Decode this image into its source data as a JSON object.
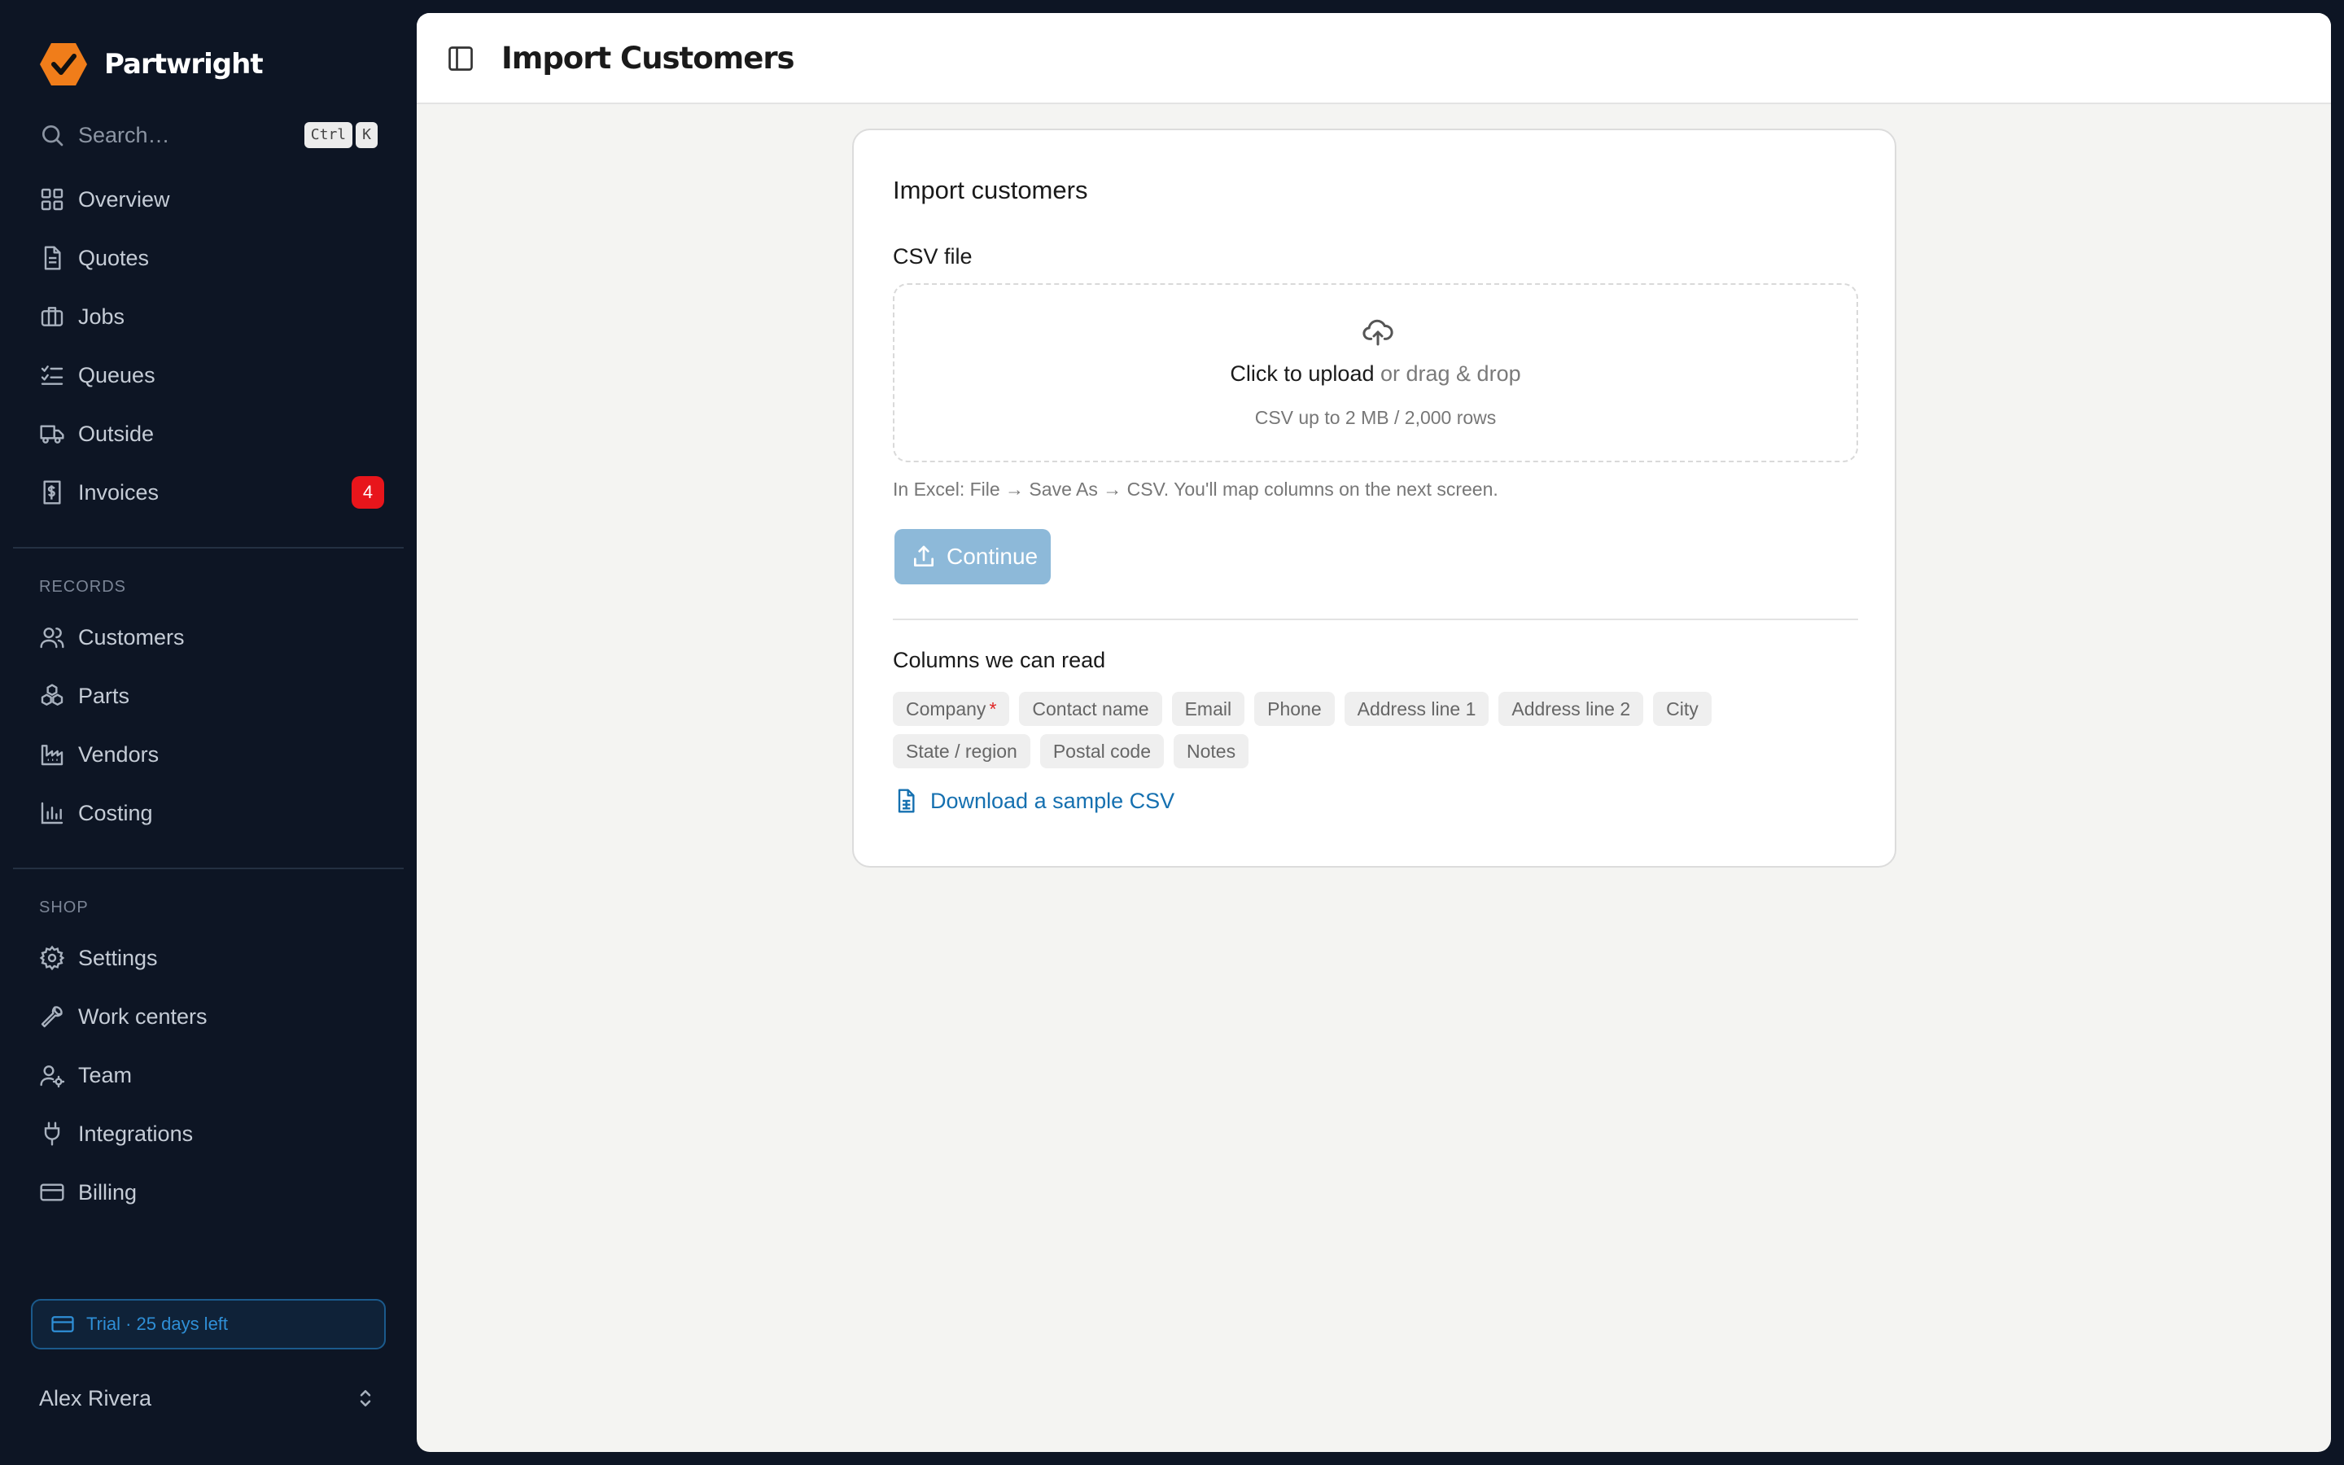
{
  "app": {
    "name": "Partwright"
  },
  "search": {
    "placeholder": "Search…",
    "shortcut": [
      "Ctrl",
      "K"
    ]
  },
  "nav_main": [
    {
      "label": "Overview",
      "icon": "grid-icon"
    },
    {
      "label": "Quotes",
      "icon": "document-icon"
    },
    {
      "label": "Jobs",
      "icon": "briefcase-icon"
    },
    {
      "label": "Queues",
      "icon": "checklist-icon"
    },
    {
      "label": "Outside",
      "icon": "truck-icon"
    },
    {
      "label": "Invoices",
      "icon": "invoice-icon",
      "badge": "4"
    }
  ],
  "sections": {
    "records": {
      "label": "RECORDS",
      "items": [
        {
          "label": "Customers",
          "icon": "users-icon"
        },
        {
          "label": "Parts",
          "icon": "parts-icon"
        },
        {
          "label": "Vendors",
          "icon": "factory-icon"
        },
        {
          "label": "Costing",
          "icon": "bar-chart-icon"
        }
      ]
    },
    "shop": {
      "label": "SHOP",
      "items": [
        {
          "label": "Settings",
          "icon": "gear-icon"
        },
        {
          "label": "Work centers",
          "icon": "wrench-icon"
        },
        {
          "label": "Team",
          "icon": "user-cog-icon"
        },
        {
          "label": "Integrations",
          "icon": "plug-icon"
        },
        {
          "label": "Billing",
          "icon": "credit-card-icon"
        }
      ]
    }
  },
  "trial": {
    "text": "Trial · 25 days left"
  },
  "user": {
    "name": "Alex Rivera"
  },
  "header": {
    "title": "Import Customers"
  },
  "card": {
    "title": "Import customers",
    "field_label": "CSV file",
    "dropzone": {
      "cta": "Click to upload",
      "alt": "or drag & drop",
      "hint": "CSV up to 2 MB / 2,000 rows"
    },
    "help": "In Excel: File → Save As → CSV. You'll map columns on the next screen.",
    "continue_label": "Continue",
    "columns_title": "Columns we can read",
    "columns": [
      {
        "label": "Company",
        "required": true
      },
      {
        "label": "Contact name"
      },
      {
        "label": "Email"
      },
      {
        "label": "Phone"
      },
      {
        "label": "Address line 1"
      },
      {
        "label": "Address line 2"
      },
      {
        "label": "City"
      },
      {
        "label": "State / region"
      },
      {
        "label": "Postal code"
      },
      {
        "label": "Notes"
      }
    ],
    "required_marker": "*",
    "download_label": "Download a sample CSV"
  },
  "colors": {
    "brand_orange": "#f07d1a",
    "sidebar_bg": "#0d1524",
    "badge_red": "#e8151b",
    "button_disabled": "#8db9d9",
    "link_blue": "#1570b0",
    "trial_blue": "#2f8fd6"
  }
}
